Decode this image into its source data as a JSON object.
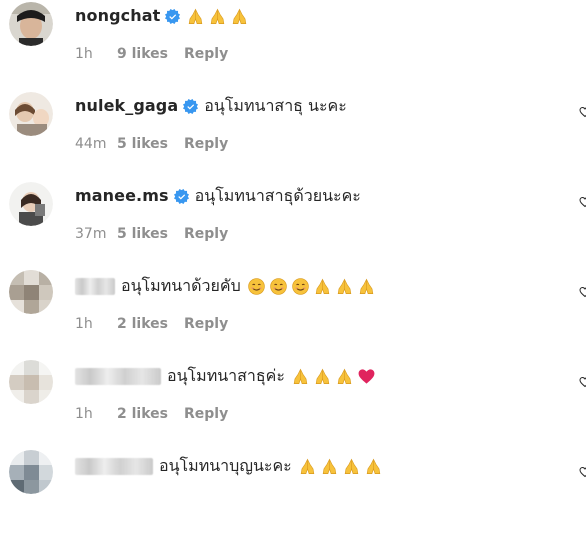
{
  "comments": [
    {
      "username": "nongchat",
      "verified": true,
      "text": "",
      "emojis": [
        "pray",
        "pray",
        "pray"
      ],
      "time": "1h",
      "likes": "9 likes",
      "reply": "Reply"
    },
    {
      "username": "nulek_gaga",
      "verified": true,
      "text": "อนุโมทนาสาธุ นะคะ",
      "emojis": [],
      "time": "44m",
      "likes": "5 likes",
      "reply": "Reply"
    },
    {
      "username": "manee.ms",
      "verified": true,
      "text": "อนุโมทนาสาธุด้วยนะคะ",
      "emojis": [],
      "time": "37m",
      "likes": "5 likes",
      "reply": "Reply"
    },
    {
      "username": "",
      "verified": false,
      "text": "อนุโมทนาด้วยคับ",
      "emojis": [
        "smile",
        "smile",
        "smile",
        "pray",
        "pray",
        "pray"
      ],
      "time": "1h",
      "likes": "2 likes",
      "reply": "Reply"
    },
    {
      "username": "",
      "verified": false,
      "text": "อนุโมทนาสาธุค่ะ",
      "emojis": [
        "pray",
        "pray",
        "pray",
        "heart"
      ],
      "time": "1h",
      "likes": "2 likes",
      "reply": "Reply"
    },
    {
      "username": "",
      "verified": false,
      "text": "อนุโมทนาบุญนะคะ",
      "emojis": [
        "pray",
        "pray",
        "pray",
        "pray"
      ],
      "time": "",
      "likes": "",
      "reply": ""
    }
  ],
  "colors": {
    "verified_blue": "#3897f0",
    "meta_gray": "#8e8e8e",
    "text_dark": "#262626",
    "emoji_yellow": "#f7c23b",
    "heart_red": "#e0245e"
  },
  "icons": {
    "verified": "verified-badge-icon",
    "pray": "folded-hands-emoji-icon",
    "smile": "smiling-face-emoji-icon",
    "heart": "red-heart-emoji-icon",
    "like": "heart-like-icon"
  }
}
